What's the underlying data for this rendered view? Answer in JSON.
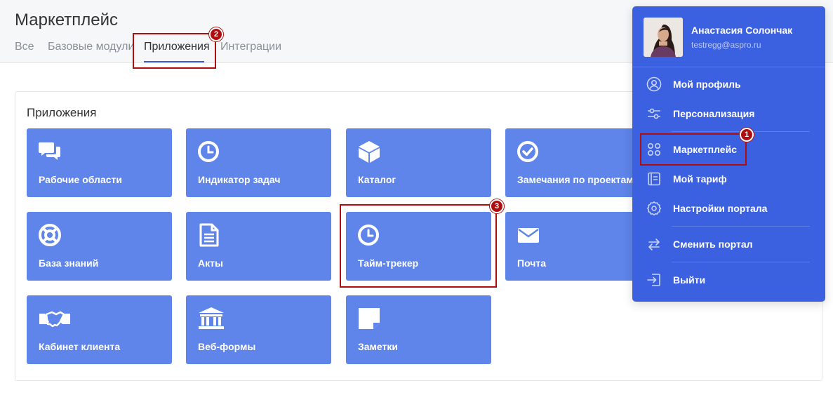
{
  "header": {
    "title": "Маркетплейс",
    "tabs": [
      {
        "label": "Все"
      },
      {
        "label": "Базовые модули"
      },
      {
        "label": "Приложения"
      },
      {
        "label": "Интеграции"
      }
    ]
  },
  "section": {
    "title": "Приложения",
    "tiles": [
      {
        "label": "Рабочие области",
        "icon": "chat-icon"
      },
      {
        "label": "Индикатор задач",
        "icon": "clock-icon"
      },
      {
        "label": "Каталог",
        "icon": "box-icon"
      },
      {
        "label": "Замечания по проектам",
        "icon": "check-circle-icon"
      },
      {
        "label": "База знаний",
        "icon": "lifebuoy-icon"
      },
      {
        "label": "Акты",
        "icon": "document-icon"
      },
      {
        "label": "Тайм-трекер",
        "icon": "clock-icon"
      },
      {
        "label": "Почта",
        "icon": "mail-icon"
      },
      {
        "label": "Кабинет клиента",
        "icon": "handshake-icon"
      },
      {
        "label": "Веб-формы",
        "icon": "bank-icon"
      },
      {
        "label": "Заметки",
        "icon": "note-icon"
      }
    ]
  },
  "user_menu": {
    "name": "Анастасия Солончак",
    "email": "testregg@aspro.ru",
    "items": [
      {
        "label": "Мой профиль",
        "icon": "user-circle-icon"
      },
      {
        "label": "Персонализация",
        "icon": "sliders-icon"
      },
      {
        "label": "Маркетплейс",
        "icon": "grid-dots-icon"
      },
      {
        "label": "Мой тариф",
        "icon": "tariff-icon"
      },
      {
        "label": "Настройки портала",
        "icon": "gear-icon"
      },
      {
        "label": "Сменить портал",
        "icon": "swap-icon"
      },
      {
        "label": "Выйти",
        "icon": "logout-icon"
      }
    ]
  },
  "annotations": [
    "1",
    "2",
    "3"
  ],
  "colors": {
    "tile": "#5f85ea",
    "menu": "#3c61e0",
    "annotation": "#b00e0e",
    "tab_underline": "#3b5bdb"
  }
}
